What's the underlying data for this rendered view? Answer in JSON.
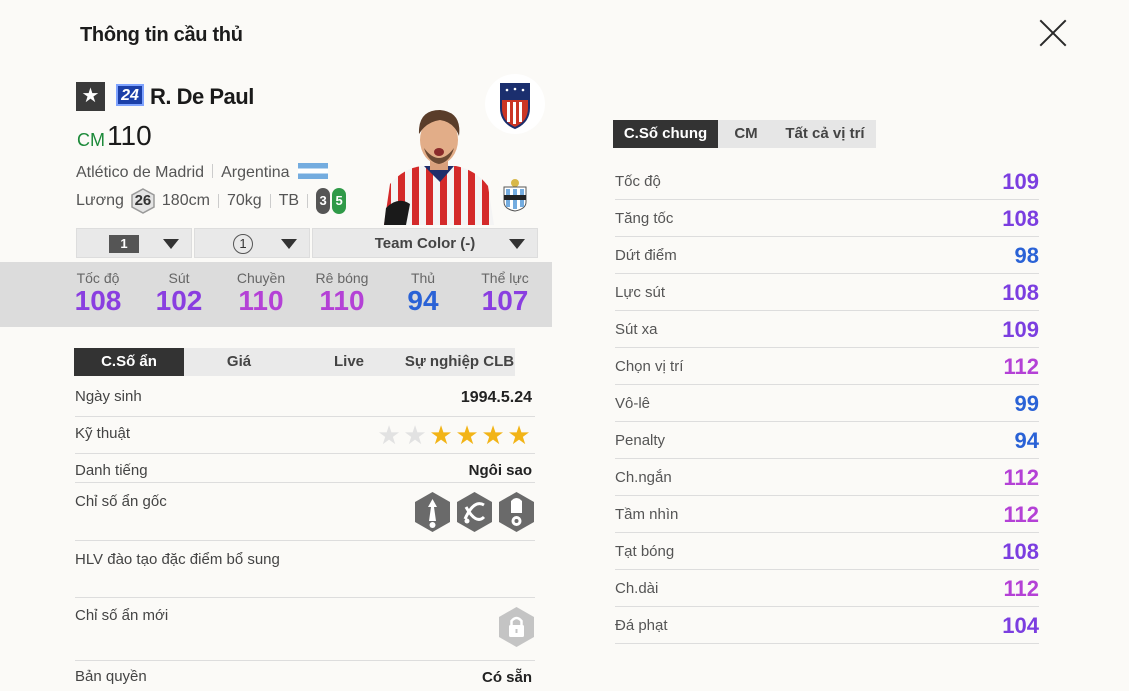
{
  "header": {
    "title": "Thông tin cầu thủ"
  },
  "player": {
    "season_badge": "24",
    "name": "R. De Paul",
    "position": "CM",
    "ovr": "110",
    "club": "Atlético de Madrid",
    "nation": "Argentina",
    "wage_label": "Lương",
    "wage": "26",
    "height": "180cm",
    "weight": "70kg",
    "body_type": "TB",
    "weak_foot": "3",
    "strong_foot": "5"
  },
  "dropdowns": {
    "upgrade": "1",
    "level": "1",
    "team_color": "Team Color (-)"
  },
  "summary_stats": [
    {
      "label": "Tốc độ",
      "value": "108",
      "color": "#8a3ee0"
    },
    {
      "label": "Sút",
      "value": "102",
      "color": "#8a3ee0"
    },
    {
      "label": "Chuyền",
      "value": "110",
      "color": "#b441d6"
    },
    {
      "label": "Rê bóng",
      "value": "110",
      "color": "#b441d6"
    },
    {
      "label": "Thủ",
      "value": "94",
      "color": "#2a62d6"
    },
    {
      "label": "Thể lực",
      "value": "107",
      "color": "#8a3ee0"
    }
  ],
  "left_tabs": [
    "C.Số ẩn",
    "Giá",
    "Live",
    "Sự nghiệp CLB"
  ],
  "info": {
    "birth_label": "Ngày sinh",
    "birth": "1994.5.24",
    "skill_label": "Kỹ thuật",
    "skill_stars": 4,
    "fame_label": "Danh tiếng",
    "fame": "Ngôi sao",
    "traits_label": "Chỉ số ẩn gốc",
    "coach_label": "HLV đào tạo đặc điểm bổ sung",
    "new_traits_label": "Chỉ số ẩn mới",
    "license_label": "Bản quyền",
    "license": "Có sẵn"
  },
  "right_tabs": [
    "C.Số chung",
    "CM",
    "Tất cả vị trí"
  ],
  "attributes": [
    {
      "label": "Tốc độ",
      "value": "109",
      "color": "#7b3ee0"
    },
    {
      "label": "Tăng tốc",
      "value": "108",
      "color": "#7b3ee0"
    },
    {
      "label": "Dứt điểm",
      "value": "98",
      "color": "#2a62d6"
    },
    {
      "label": "Lực sút",
      "value": "108",
      "color": "#7b3ee0"
    },
    {
      "label": "Sút xa",
      "value": "109",
      "color": "#7b3ee0"
    },
    {
      "label": "Chọn vị trí",
      "value": "112",
      "color": "#b441d6"
    },
    {
      "label": "Vô-lê",
      "value": "99",
      "color": "#2a62d6"
    },
    {
      "label": "Penalty",
      "value": "94",
      "color": "#2a62d6"
    },
    {
      "label": "Ch.ngắn",
      "value": "112",
      "color": "#b441d6"
    },
    {
      "label": "Tầm nhìn",
      "value": "112",
      "color": "#b441d6"
    },
    {
      "label": "Tạt bóng",
      "value": "108",
      "color": "#7b3ee0"
    },
    {
      "label": "Ch.dài",
      "value": "112",
      "color": "#b441d6"
    },
    {
      "label": "Đá phạt",
      "value": "104",
      "color": "#7b3ee0"
    }
  ]
}
